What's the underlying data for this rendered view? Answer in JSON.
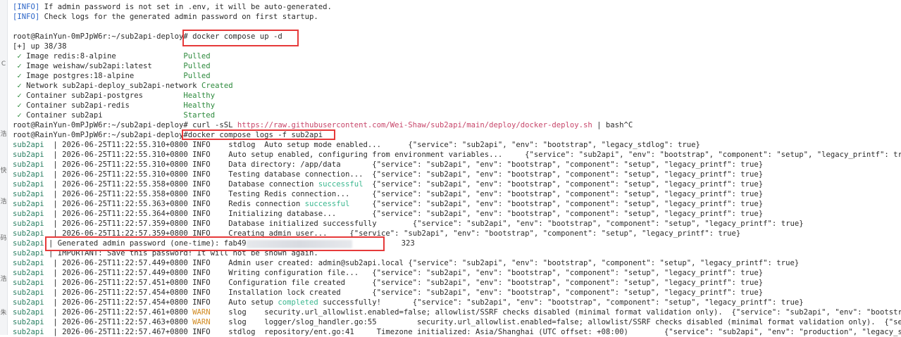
{
  "intro": {
    "tag": "[INFO]",
    "line1": " If admin password is not set in .env, it will be auto-generated.",
    "line2": " Check logs for the generated admin password on first startup."
  },
  "prompt": "root@RainYun-0mPJpW6r:~/sub2api-deploy#",
  "commands": {
    "compose_up": "docker compose up -d",
    "curl_prefix": "curl -sSL ",
    "curl_url": "https://raw.githubusercontent.com/Wei-Shaw/sub2api/main/deploy/docker-deploy.sh",
    "curl_suffix": " | bash^C",
    "compose_logs": "docker compose logs -f sub2api"
  },
  "compose_progress": "[+] up 38/38",
  "check_mark": "✓",
  "compose_items": [
    {
      "label": "Image redis:8-alpine              ",
      "status": "Pulled"
    },
    {
      "label": "Image weishaw/sub2api:latest      ",
      "status": "Pulled"
    },
    {
      "label": "Image postgres:18-alpine          ",
      "status": "Pulled"
    },
    {
      "label": "Network sub2api-deploy_sub2api-network",
      "status": "Created"
    },
    {
      "label": "Container sub2api-postgres        ",
      "status": "Healthy"
    },
    {
      "label": "Container sub2api-redis           ",
      "status": "Healthy"
    },
    {
      "label": "Container sub2api                 ",
      "status": "Started"
    }
  ],
  "log_service": "sub2api",
  "logs": [
    {
      "ts": "2026-06-25T11:22:55.310+0800",
      "level": "INFO",
      "msg": "stdlog  Auto setup mode enabled...",
      "hl": "",
      "after": "",
      "fields": "      {\"service\": \"sub2api\", \"env\": \"bootstrap\", \"legacy_stdlog\": true}"
    },
    {
      "ts": "2026-06-25T11:22:55.310+0800",
      "level": "INFO",
      "msg": "Auto setup enabled, configuring from environment variables...",
      "hl": "",
      "after": "",
      "fields": "     {\"service\": \"sub2api\", \"env\": \"bootstrap\", \"component\": \"setup\", \"legacy_printf\": true}"
    },
    {
      "ts": "2026-06-25T11:22:55.310+0800",
      "level": "INFO",
      "msg": "Data directory: /app/data",
      "hl": "",
      "after": "",
      "fields": "       {\"service\": \"sub2api\", \"env\": \"bootstrap\", \"component\": \"setup\", \"legacy_printf\": true}"
    },
    {
      "ts": "2026-06-25T11:22:55.310+0800",
      "level": "INFO",
      "msg": "Testing database connection...",
      "hl": "",
      "after": "",
      "fields": "  {\"service\": \"sub2api\", \"env\": \"bootstrap\", \"component\": \"setup\", \"legacy_printf\": true}"
    },
    {
      "ts": "2026-06-25T11:22:55.358+0800",
      "level": "INFO",
      "msg": "Database connection ",
      "hl": "successful",
      "after": "",
      "fields": "  {\"service\": \"sub2api\", \"env\": \"bootstrap\", \"component\": \"setup\", \"legacy_printf\": true}"
    },
    {
      "ts": "2026-06-25T11:22:55.358+0800",
      "level": "INFO",
      "msg": "Testing Redis connection...",
      "hl": "",
      "after": "",
      "fields": "     {\"service\": \"sub2api\", \"env\": \"bootstrap\", \"component\": \"setup\", \"legacy_printf\": true}"
    },
    {
      "ts": "2026-06-25T11:22:55.363+0800",
      "level": "INFO",
      "msg": "Redis connection ",
      "hl": "successful",
      "after": "",
      "fields": "     {\"service\": \"sub2api\", \"env\": \"bootstrap\", \"component\": \"setup\", \"legacy_printf\": true}"
    },
    {
      "ts": "2026-06-25T11:22:55.364+0800",
      "level": "INFO",
      "msg": "Initializing database...",
      "hl": "",
      "after": "",
      "fields": "        {\"service\": \"sub2api\", \"env\": \"bootstrap\", \"component\": \"setup\", \"legacy_printf\": true}"
    },
    {
      "ts": "2026-06-25T11:22:57.359+0800",
      "level": "INFO",
      "msg": "Database initialized successfully",
      "hl": "",
      "after": "",
      "fields": "        {\"service\": \"sub2api\", \"env\": \"bootstrap\", \"component\": \"setup\", \"legacy_printf\": true}"
    },
    {
      "ts": "2026-06-25T11:22:57.359+0800",
      "level": "INFO",
      "msg": "Creating admin user...",
      "hl": "",
      "after": "",
      "fields": "     {\"service\": \"sub2api\", \"env\": \"bootstrap\", \"component\": \"setup\", \"legacy_printf\": true}"
    }
  ],
  "password_line": {
    "text": "Generated admin password (one-time): fab49",
    "tail": "323"
  },
  "important_line": "IMPORTANT: Save this password! It will not be shown again.",
  "logs2": [
    {
      "ts": "2026-06-25T11:22:57.449+0800",
      "level": "INFO",
      "msg": "Admin user created: admin@sub2api.local",
      "hl": "",
      "after": "",
      "fields": " {\"service\": \"sub2api\", \"env\": \"bootstrap\", \"component\": \"setup\", \"legacy_printf\": true}"
    },
    {
      "ts": "2026-06-25T11:22:57.449+0800",
      "level": "INFO",
      "msg": "Writing configuration file...",
      "hl": "",
      "after": "",
      "fields": "   {\"service\": \"sub2api\", \"env\": \"bootstrap\", \"component\": \"setup\", \"legacy_printf\": true}"
    },
    {
      "ts": "2026-06-25T11:22:57.451+0800",
      "level": "INFO",
      "msg": "Configuration file created",
      "hl": "",
      "after": "",
      "fields": "      {\"service\": \"sub2api\", \"env\": \"bootstrap\", \"component\": \"setup\", \"legacy_printf\": true}"
    },
    {
      "ts": "2026-06-25T11:22:57.454+0800",
      "level": "INFO",
      "msg": "Installation lock created",
      "hl": "",
      "after": "",
      "fields": "       {\"service\": \"sub2api\", \"env\": \"bootstrap\", \"component\": \"setup\", \"legacy_printf\": true}"
    },
    {
      "ts": "2026-06-25T11:22:57.454+0800",
      "level": "INFO",
      "msg": "Auto setup ",
      "hl": "completed",
      "after": " successfully!",
      "fields": "       {\"service\": \"sub2api\", \"env\": \"bootstrap\", \"component\": \"setup\", \"legacy_printf\": true}"
    },
    {
      "ts": "2026-06-25T11:22:57.461+0800",
      "level": "WARN",
      "msg": "slog    security.url_allowlist.enabled=false; allowlist/SSRF checks disabled (minimal format validation only).",
      "hl": "",
      "after": "",
      "fields": "  {\"service\": \"sub2api\", \"env\": \"bootstrap\"}"
    },
    {
      "ts": "2026-06-25T11:22:57.463+0800",
      "level": "WARN",
      "msg": "slog    logger/slog_handler.go:55         security.url_allowlist.enabled=false; allowlist/SSRF checks disabled (minimal format validation only).",
      "hl": "",
      "after": "",
      "fields": "  {\"service\":"
    },
    {
      "ts": "2026-06-25T11:22:57.467+0800",
      "level": "INFO",
      "msg": "stdlog  repository/ent.go:41     Timezone initialized: Asia/Shanghai (UTC offset: +08:00)",
      "hl": "",
      "after": "",
      "fields": "        {\"service\": \"sub2api\", \"env\": \"production\", \"legacy_stdlog\""
    }
  ],
  "left_strip_glyphs": [
    "C",
    "浩",
    "快",
    "浩",
    "码",
    "浩",
    "朱"
  ]
}
